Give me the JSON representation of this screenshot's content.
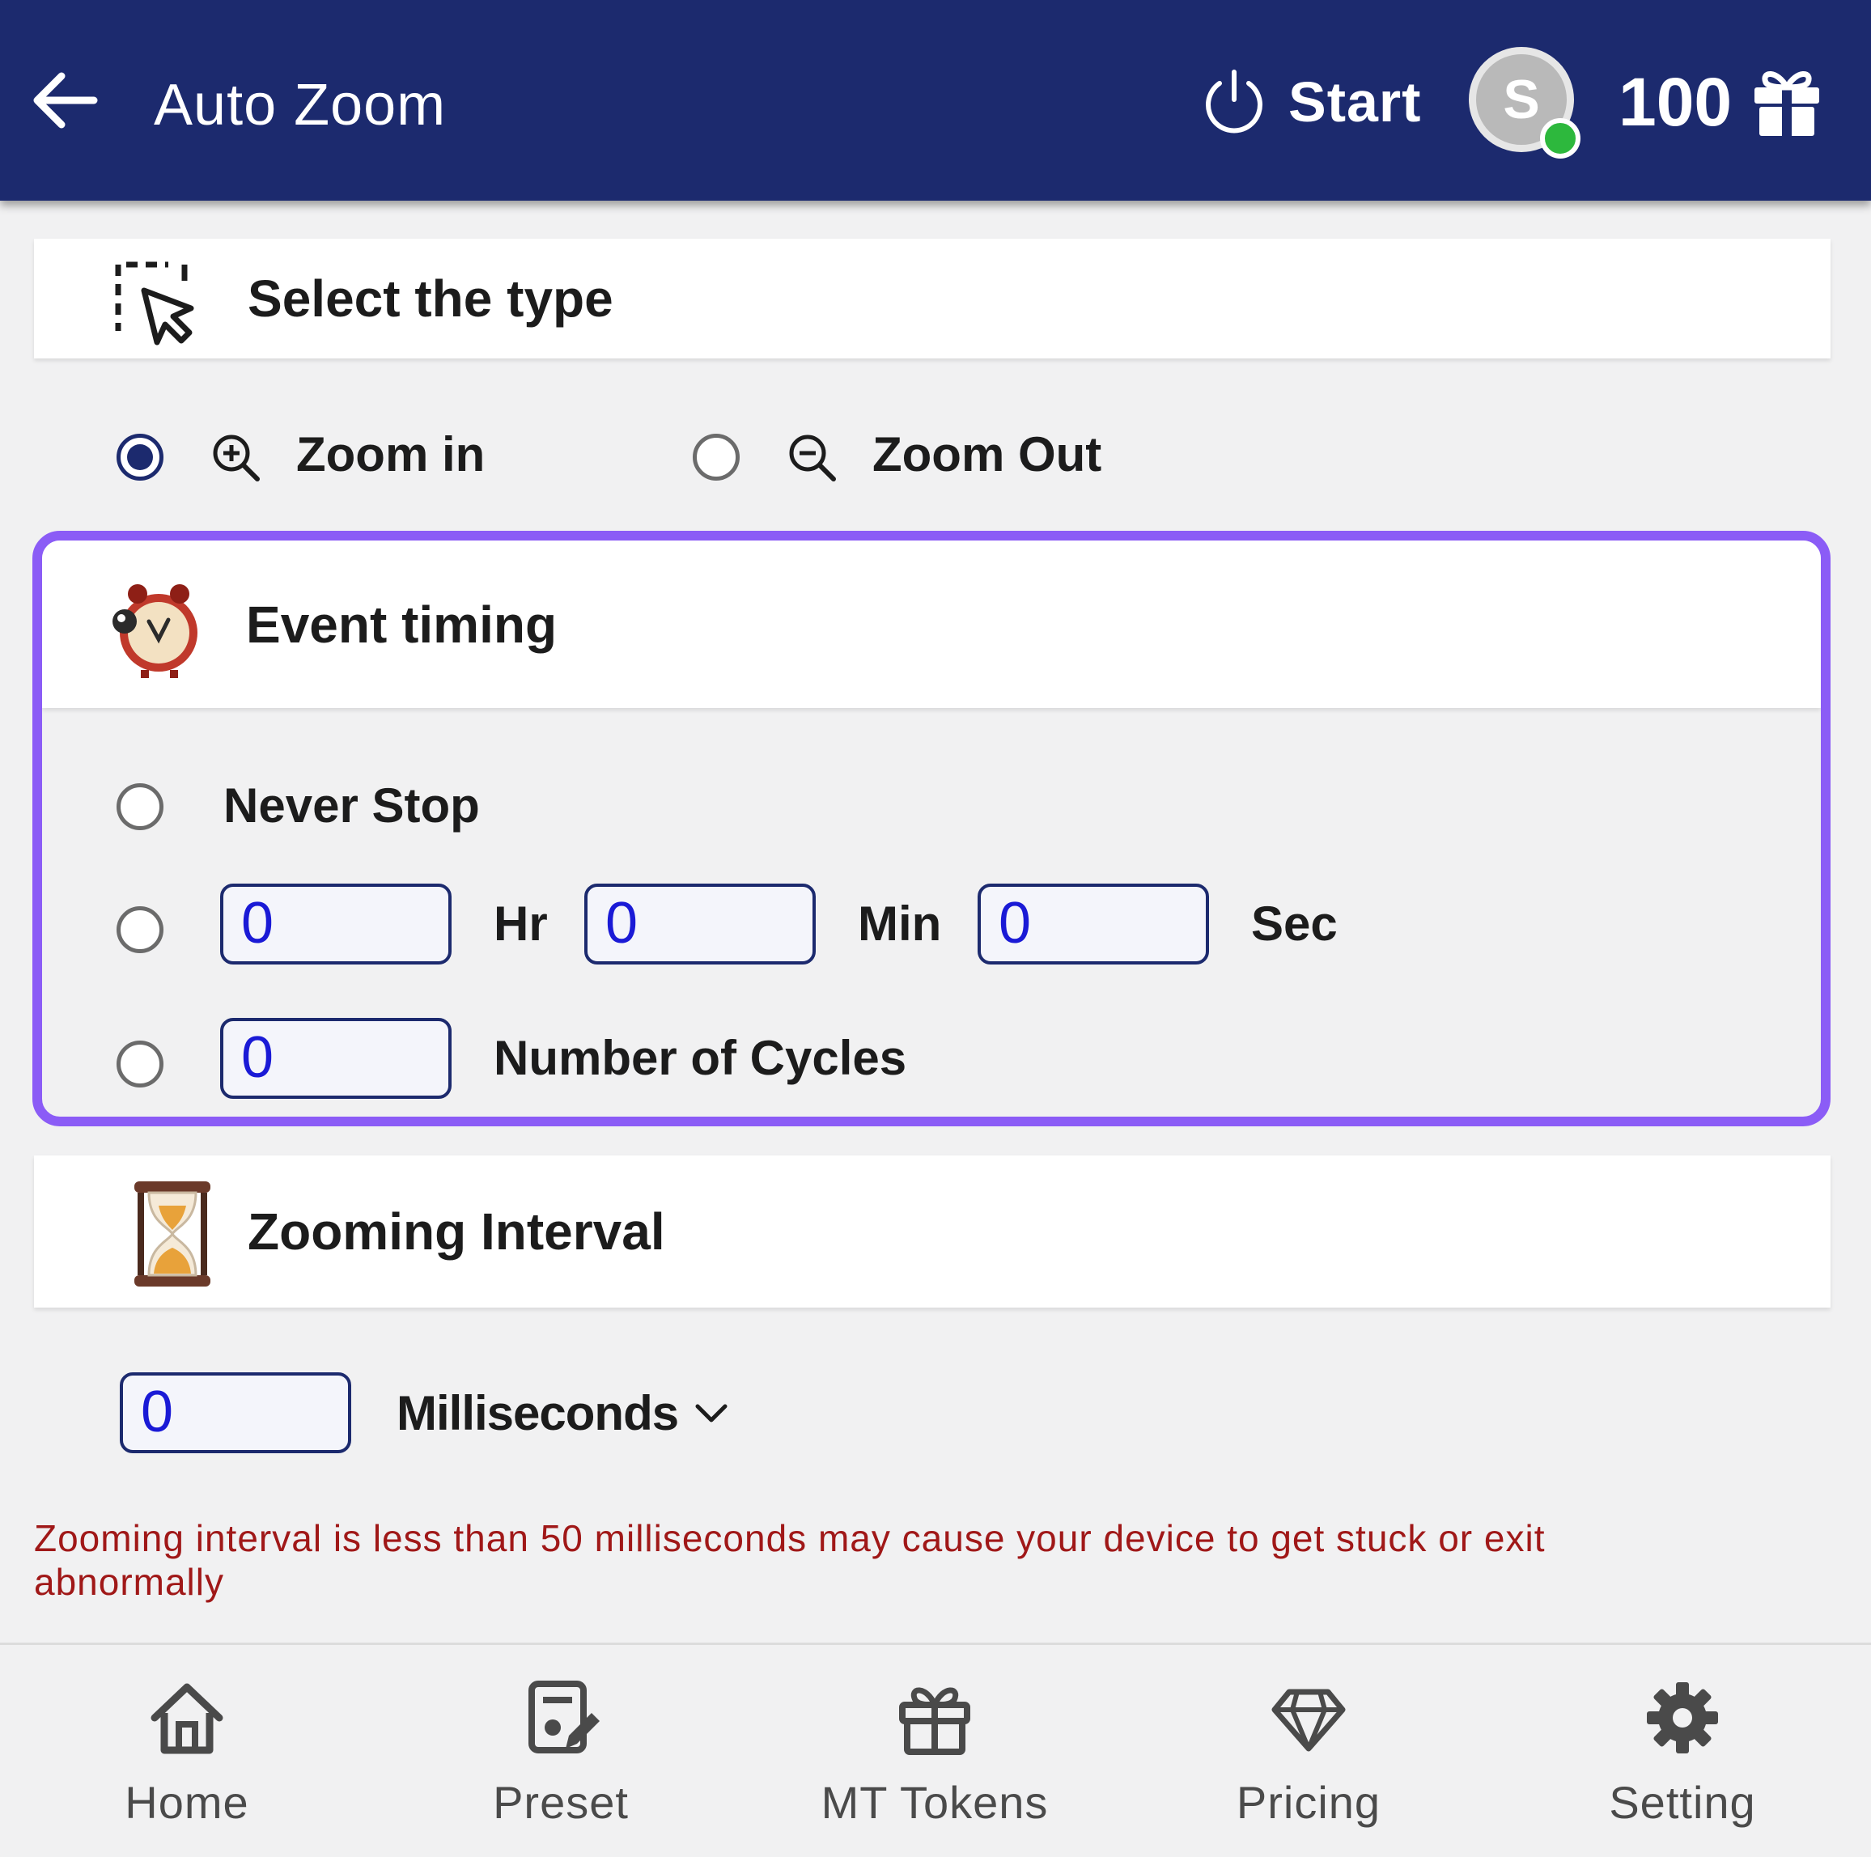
{
  "header": {
    "title": "Auto Zoom",
    "start_label": "Start",
    "avatar_letter": "S",
    "token_count": "100"
  },
  "select_type": {
    "title": "Select the type",
    "options": [
      {
        "label": "Zoom in",
        "selected": true
      },
      {
        "label": "Zoom Out",
        "selected": false
      }
    ]
  },
  "event_timing": {
    "title": "Event timing",
    "never_stop_label": "Never Stop",
    "duration": {
      "hr_value": "0",
      "hr_label": "Hr",
      "min_value": "0",
      "min_label": "Min",
      "sec_value": "0",
      "sec_label": "Sec"
    },
    "cycles": {
      "value": "0",
      "label": "Number of Cycles"
    }
  },
  "zooming_interval": {
    "title": "Zooming Interval",
    "value": "0",
    "unit": "Milliseconds",
    "warning": "Zooming interval is less than 50 milliseconds may cause your device to get stuck or exit abnormally"
  },
  "bottom_nav": {
    "items": [
      {
        "label": "Home",
        "icon": "home-icon"
      },
      {
        "label": "Preset",
        "icon": "preset-icon"
      },
      {
        "label": "MT Tokens",
        "icon": "gift-icon"
      },
      {
        "label": "Pricing",
        "icon": "diamond-icon"
      },
      {
        "label": "Setting",
        "icon": "gear-icon"
      }
    ]
  },
  "colors": {
    "header_bg": "#1c2a6e",
    "highlight_border": "#8b5cf6",
    "input_text": "#1a1ad6",
    "warning_text": "#a01818",
    "online": "#2db83d"
  }
}
